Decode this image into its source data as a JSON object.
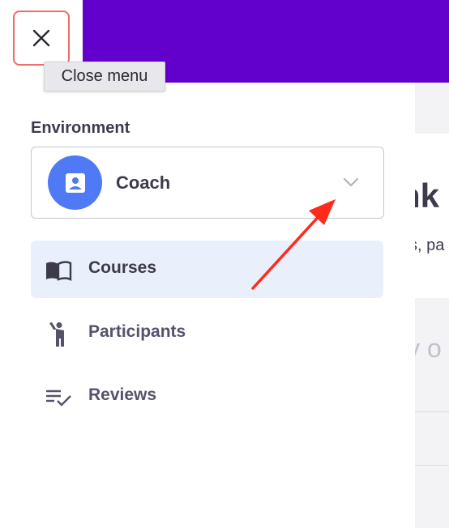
{
  "close_button": {
    "label": "Close menu"
  },
  "environment": {
    "label": "Environment",
    "value": "Coach"
  },
  "nav": [
    {
      "label": "Courses",
      "icon": "book-icon",
      "active": true
    },
    {
      "label": "Participants",
      "icon": "person-raised-hand-icon",
      "active": false
    },
    {
      "label": "Reviews",
      "icon": "checklist-icon",
      "active": false
    }
  ],
  "background": {
    "heading_fragment": "nk",
    "subtitle_fragment": "s, pa",
    "faded_fragment": "ly o"
  },
  "colors": {
    "topbar": "#6200cc",
    "accent": "#4f79f5",
    "active_nav_bg": "#e9f0fc",
    "annotation_arrow": "#ff2a1a",
    "close_focus_border": "#f06b6b"
  }
}
